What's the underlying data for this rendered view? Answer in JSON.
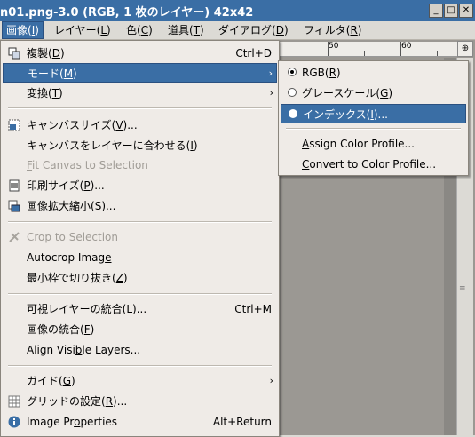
{
  "window": {
    "title": "n01.png-3.0 (RGB, 1 枚のレイヤー) 42x42",
    "minimize": "_",
    "maximize": "□",
    "close": "✕"
  },
  "menubar": {
    "image": {
      "pre": "画像(",
      "key": "I",
      "post": ")"
    },
    "layer": {
      "pre": "レイヤー(",
      "key": "L",
      "post": ")"
    },
    "color": {
      "pre": "色(",
      "key": "C",
      "post": ")"
    },
    "tools": {
      "pre": "道具(",
      "key": "T",
      "post": ")"
    },
    "dialogs": {
      "pre": "ダイアログ(",
      "key": "D",
      "post": ")"
    },
    "filters": {
      "pre": "フィルタ(",
      "key": "R",
      "post": ")"
    }
  },
  "ruler": {
    "label_50": "50",
    "label_60": "60"
  },
  "image_menu": {
    "duplicate": {
      "pre": "複製(",
      "key": "D",
      "post": ")",
      "accel": "Ctrl+D"
    },
    "mode": {
      "pre": "モード(",
      "key": "M",
      "post": ")"
    },
    "transform": {
      "pre": "変換(",
      "key": "T",
      "post": ")"
    },
    "canvas_size": {
      "pre": "キャンバスサイズ(",
      "key": "V",
      "post": ")..."
    },
    "fit_canvas_layers": {
      "pre": "キャンバスをレイヤーに合わせる(",
      "key": "I",
      "post": ")"
    },
    "fit_canvas_selection": {
      "pre": "",
      "key": "F",
      "post": "it Canvas to Selection"
    },
    "print_size": {
      "pre": "印刷サイズ(",
      "key": "P",
      "post": ")..."
    },
    "scale_image": {
      "pre": "画像拡大縮小(",
      "key": "S",
      "post": ")..."
    },
    "crop_selection": {
      "pre": "",
      "key": "C",
      "post": "rop to Selection"
    },
    "autocrop": {
      "pre": "Autocrop Imag",
      "key": "e",
      "post": ""
    },
    "zealous_crop": {
      "pre": "最小枠で切り抜き(",
      "key": "Z",
      "post": ")"
    },
    "merge_visible": {
      "pre": "可視レイヤーの統合(",
      "key": "L",
      "post": ")...",
      "accel": "Ctrl+M"
    },
    "flatten": {
      "pre": "画像の統合(",
      "key": "F",
      "post": ")"
    },
    "align_layers": {
      "pre": "Align Visi",
      "key": "b",
      "post": "le Layers..."
    },
    "guides": {
      "pre": "ガイド(",
      "key": "G",
      "post": ")"
    },
    "grid": {
      "pre": "グリッドの設定(",
      "key": "R",
      "post": ")..."
    },
    "properties": {
      "pre": "Image Pr",
      "key": "o",
      "post": "perties",
      "accel": "Alt+Return"
    },
    "submenu_arrow": "›"
  },
  "mode_submenu": {
    "rgb": {
      "pre": "RGB(",
      "key": "R",
      "post": ")"
    },
    "grayscale": {
      "pre": "グレースケール(",
      "key": "G",
      "post": ")"
    },
    "indexed": {
      "pre": "インデックス(",
      "key": "I",
      "post": ")..."
    },
    "assign_profile": {
      "pre": "",
      "key": "A",
      "post": "ssign Color Profile..."
    },
    "convert_profile": {
      "pre": "",
      "key": "C",
      "post": "onvert to Color Profile..."
    },
    "selected": "RGB"
  },
  "icons": {
    "duplicate": "duplicate-icon",
    "canvas_size": "canvas-size-icon",
    "print_size": "print-size-icon",
    "scale": "scale-icon",
    "crop": "crop-icon",
    "grid": "grid-icon",
    "info": "info-icon",
    "zoom": "zoom-icon"
  },
  "colors": {
    "highlight": "#3a6ea5",
    "menu_bg": "#efebe7",
    "disabled": "#a09c96"
  }
}
